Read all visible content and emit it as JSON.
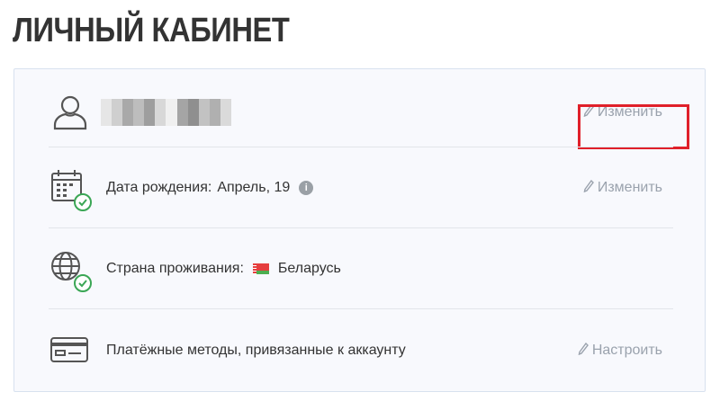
{
  "page": {
    "title": "ЛИЧНЫЙ КАБИНЕТ"
  },
  "profile": {
    "edit_label": "Изменить"
  },
  "birthday": {
    "label": "Дата рождения:",
    "value": "Апрель, 19",
    "info_glyph": "i",
    "edit_label": "Изменить"
  },
  "country": {
    "label": "Страна проживания:",
    "value": "Беларусь"
  },
  "payments": {
    "label": "Платёжные методы, привязанные к аккаунту",
    "action_label": "Настроить"
  },
  "colors": {
    "accent_red": "#e0202a",
    "check_green": "#3aa655",
    "muted": "#9aa2ad"
  },
  "icons": {
    "profile": "user-icon",
    "birthday": "calendar-icon",
    "country": "globe-icon",
    "payments": "credit-card-icon",
    "verified": "check-circle-icon",
    "edit": "pencil-icon"
  }
}
